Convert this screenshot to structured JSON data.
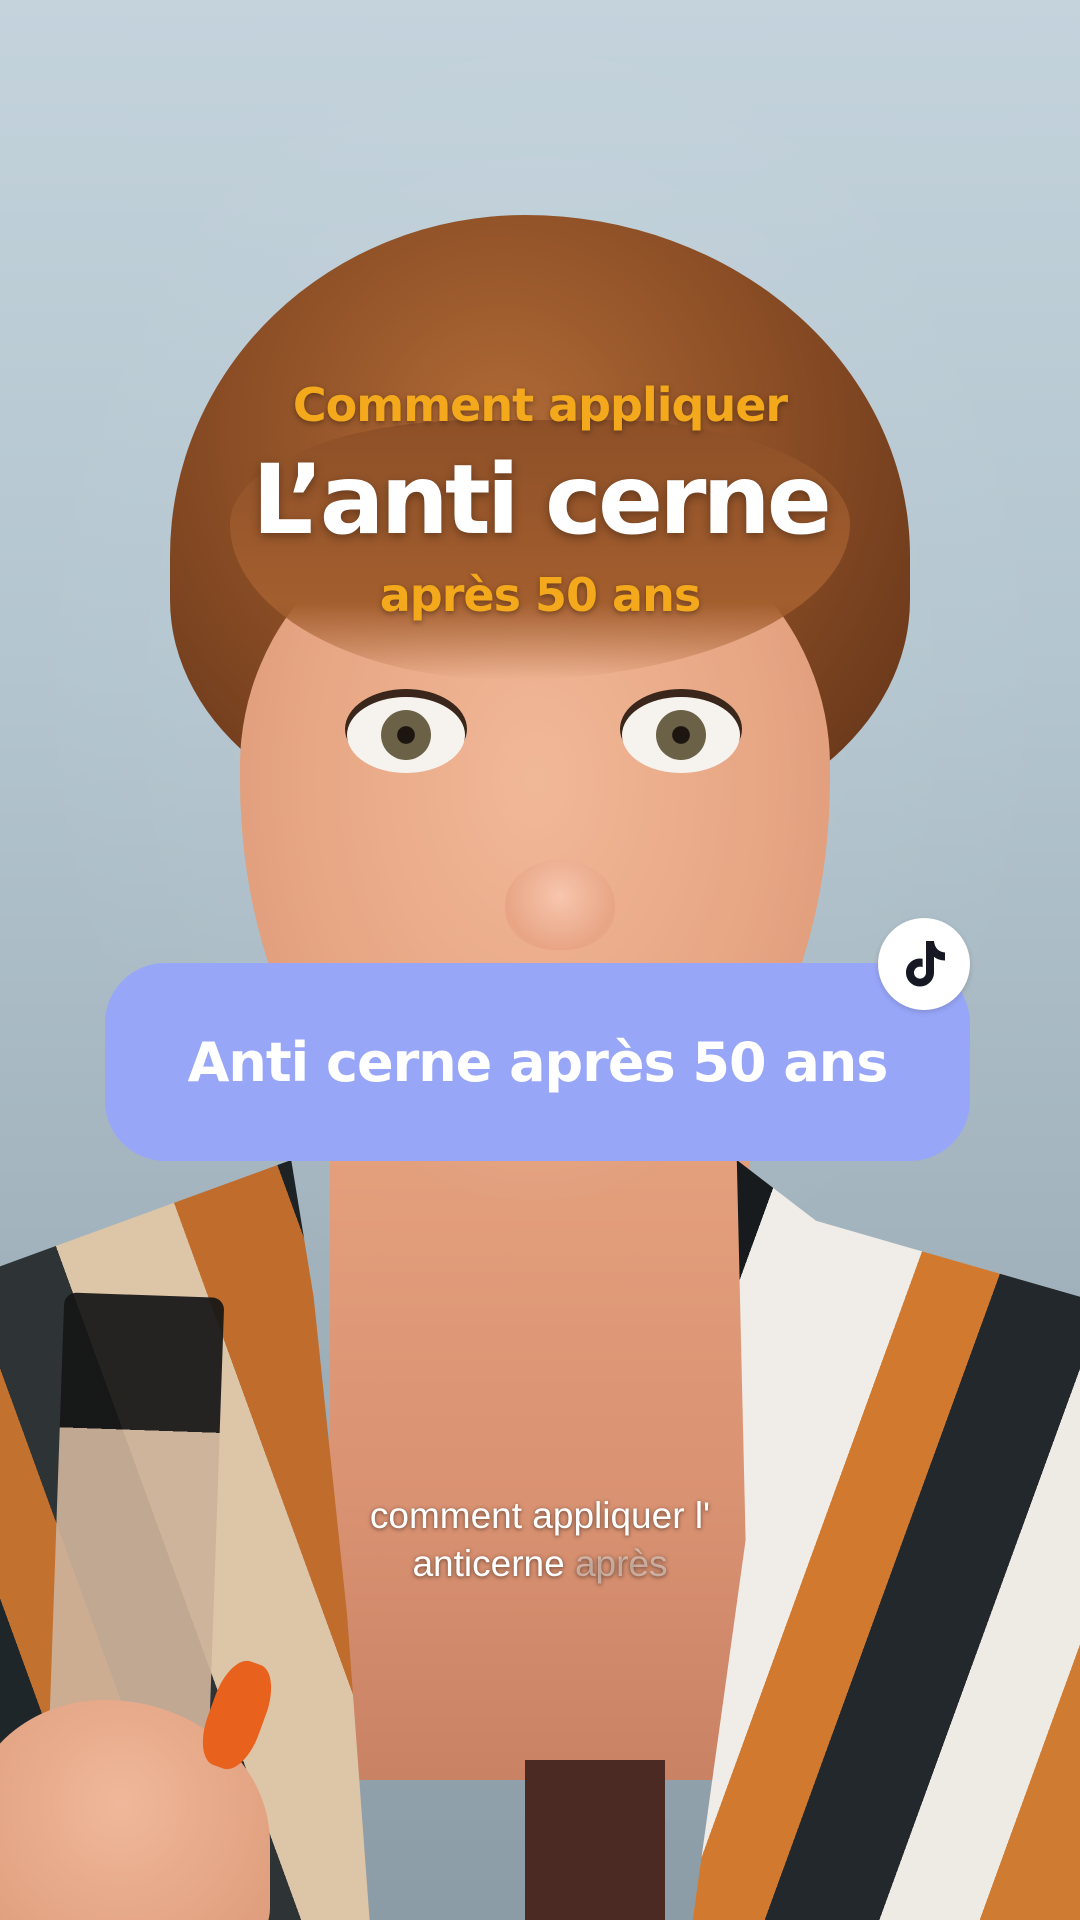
{
  "video": {
    "title_overlay": {
      "line1": "Comment appliquer",
      "line2": "L’anti cerne",
      "line3": "après 50 ans"
    },
    "subtitles": {
      "line1": "comment appliquer l'",
      "line2_spoken": "anticerne",
      "line2_upcoming": "après"
    }
  },
  "banner": {
    "text": "Anti cerne après 50 ans",
    "background_color": "#98a6f8",
    "badge_icon": "tiktok-logo-icon"
  },
  "colors": {
    "title_accent": "#f3a91b",
    "title_main": "#ffffff"
  }
}
